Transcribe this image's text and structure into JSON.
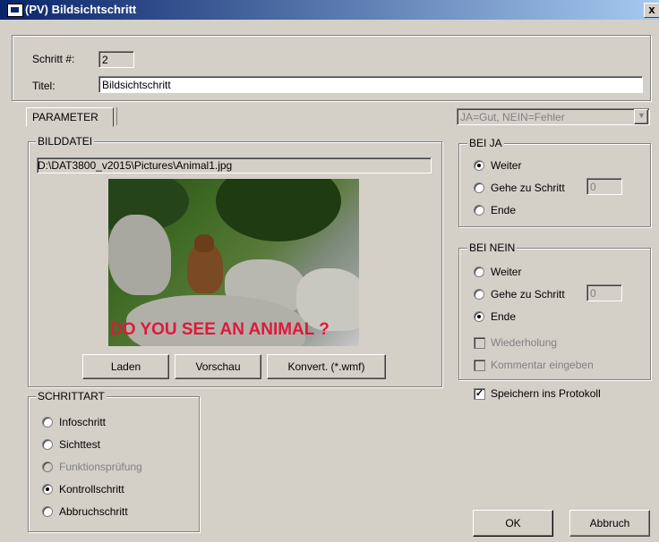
{
  "window": {
    "title": "(PV) Bildsichtschritt",
    "close_label": "x"
  },
  "header": {
    "step_label": "Schritt #:",
    "step_value": "2",
    "title_label": "Titel:",
    "title_value": "Bildsichtschritt"
  },
  "tabs": [
    {
      "label": "PARAMETER"
    }
  ],
  "condition_select": {
    "value": "JA=Gut, NEIN=Fehler"
  },
  "bilddatei": {
    "legend": "BILDDATEI",
    "path": "D:\\DAT3800_v2015\\Pictures\\Animal1.jpg",
    "image_caption": "DO YOU SEE AN ANIMAL ?",
    "buttons": {
      "load": "Laden",
      "preview": "Vorschau",
      "convert": "Konvert. (*.wmf)"
    }
  },
  "bei_ja": {
    "legend": "BEI JA",
    "options": [
      "Weiter",
      "Gehe zu Schritt",
      "Ende"
    ],
    "selected": "Weiter",
    "goto_value": "0"
  },
  "bei_nein": {
    "legend": "BEI NEIN",
    "options": [
      "Weiter",
      "Gehe zu Schritt",
      "Ende"
    ],
    "selected": "Ende",
    "goto_value": "0",
    "checkboxes": [
      {
        "label": "Wiederholung",
        "checked": false,
        "enabled": false
      },
      {
        "label": "Kommentar eingeben",
        "checked": false,
        "enabled": false
      }
    ]
  },
  "save_protocol": {
    "label": "Speichern ins Protokoll",
    "checked": true
  },
  "schrittart": {
    "legend": "SCHRITTART",
    "options": [
      {
        "label": "Infoschritt",
        "enabled": true
      },
      {
        "label": "Sichttest",
        "enabled": true
      },
      {
        "label": "Funktionsprüfung",
        "enabled": false
      },
      {
        "label": "Kontrollschritt",
        "enabled": true
      },
      {
        "label": "Abbruchschritt",
        "enabled": true
      }
    ],
    "selected": "Kontrollschritt"
  },
  "footer": {
    "ok": "OK",
    "cancel": "Abbruch"
  },
  "colors": {
    "titlebar": "#0a246a",
    "face": "#d4d0c8",
    "caption": "#e0183a"
  }
}
